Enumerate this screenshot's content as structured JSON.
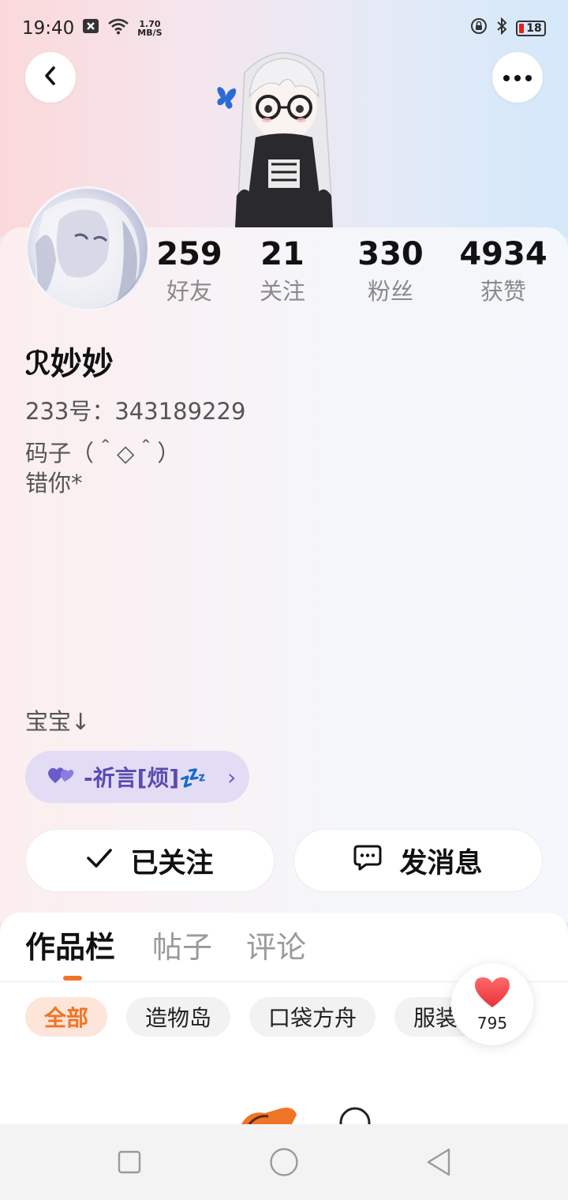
{
  "status_bar": {
    "time": "19:40",
    "net_speed_value": "1.70",
    "net_speed_unit": "MB/S",
    "battery_level": "18",
    "icons": [
      "close-box-icon",
      "wifi-icon",
      "lock-rotation-icon",
      "bluetooth-icon",
      "battery-icon"
    ]
  },
  "header": {
    "back_icon": "chevron-left-icon",
    "more_icon": "ellipsis-icon"
  },
  "profile": {
    "stats": [
      {
        "value": "259",
        "label": "好友"
      },
      {
        "value": "21",
        "label": "关注"
      },
      {
        "value": "330",
        "label": "粉丝"
      },
      {
        "value": "4934",
        "label": "获赞"
      }
    ],
    "username": "ℛ妙妙",
    "user_id": "233号：343189229",
    "bio_line_1": "码子（＾◇＾）",
    "bio_line_2": "错你*",
    "bio_line_3": "宝宝↓"
  },
  "relation_pill": {
    "text": "-祈言[烦]💤",
    "icon": "double-heart-icon",
    "arrow": "›",
    "colors": {
      "bg": "#e2dcf4",
      "text": "#5b4bb0"
    }
  },
  "actions": {
    "follow_label": "已关注",
    "message_label": "发消息"
  },
  "tabs": [
    {
      "label": "作品栏",
      "active": true
    },
    {
      "label": "帖子",
      "active": false
    },
    {
      "label": "评论",
      "active": false
    }
  ],
  "chips": [
    {
      "label": "全部",
      "active": true
    },
    {
      "label": "造物岛",
      "active": false
    },
    {
      "label": "口袋方舟",
      "active": false
    },
    {
      "label": "服装",
      "active": false
    }
  ],
  "like": {
    "count": "795",
    "icon": "heart-icon"
  },
  "colors": {
    "accent": "#f07426",
    "heart": "#f0484f"
  }
}
